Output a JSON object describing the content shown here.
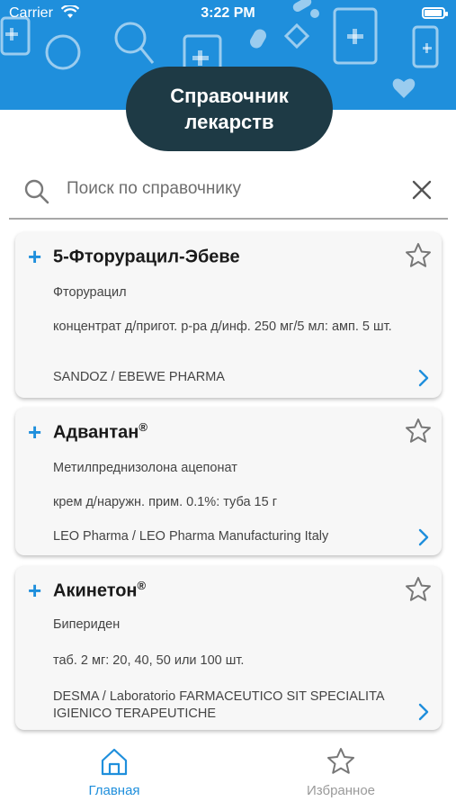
{
  "status_bar": {
    "carrier": "Carrier",
    "time": "3:22 PM",
    "battery_level": 0.95
  },
  "header": {
    "title_line1": "Справочник",
    "title_line2": "лекарств"
  },
  "search": {
    "placeholder": "Поиск по справочнику",
    "value": ""
  },
  "drugs": [
    {
      "name": "5-Фторурацил-Эбеве",
      "registered": "",
      "substance": "Фторурацил",
      "form": "концентрат д/пригот. р-ра д/инф. 250 мг/5 мл: амп. 5 шт.",
      "manufacturer": "SANDOZ / EBEWE PHARMA"
    },
    {
      "name": "Адвантан",
      "registered": "®",
      "substance": "Метилпреднизолона ацепонат",
      "form": "крем д/наружн. прим. 0.1%: туба 15 г",
      "manufacturer": "LEO Pharma / LEO Pharma Manufacturing Italy"
    },
    {
      "name": "Акинетон",
      "registered": "®",
      "substance": "Бипериден",
      "form": "таб. 2 мг: 20, 40, 50 или 100 шт.",
      "manufacturer": "DESMA / Laboratorio FARMACEUTICO SIT SPECIALITA IGIENICO TERAPEUTICHE"
    }
  ],
  "tabbar": {
    "home_label": "Главная",
    "favorites_label": "Избранное",
    "active": "home"
  },
  "colors": {
    "accent": "#1f8fdc",
    "title_pill": "#1e3a45",
    "card_bg": "#f7f7f7",
    "inactive": "#9a9a9a"
  }
}
